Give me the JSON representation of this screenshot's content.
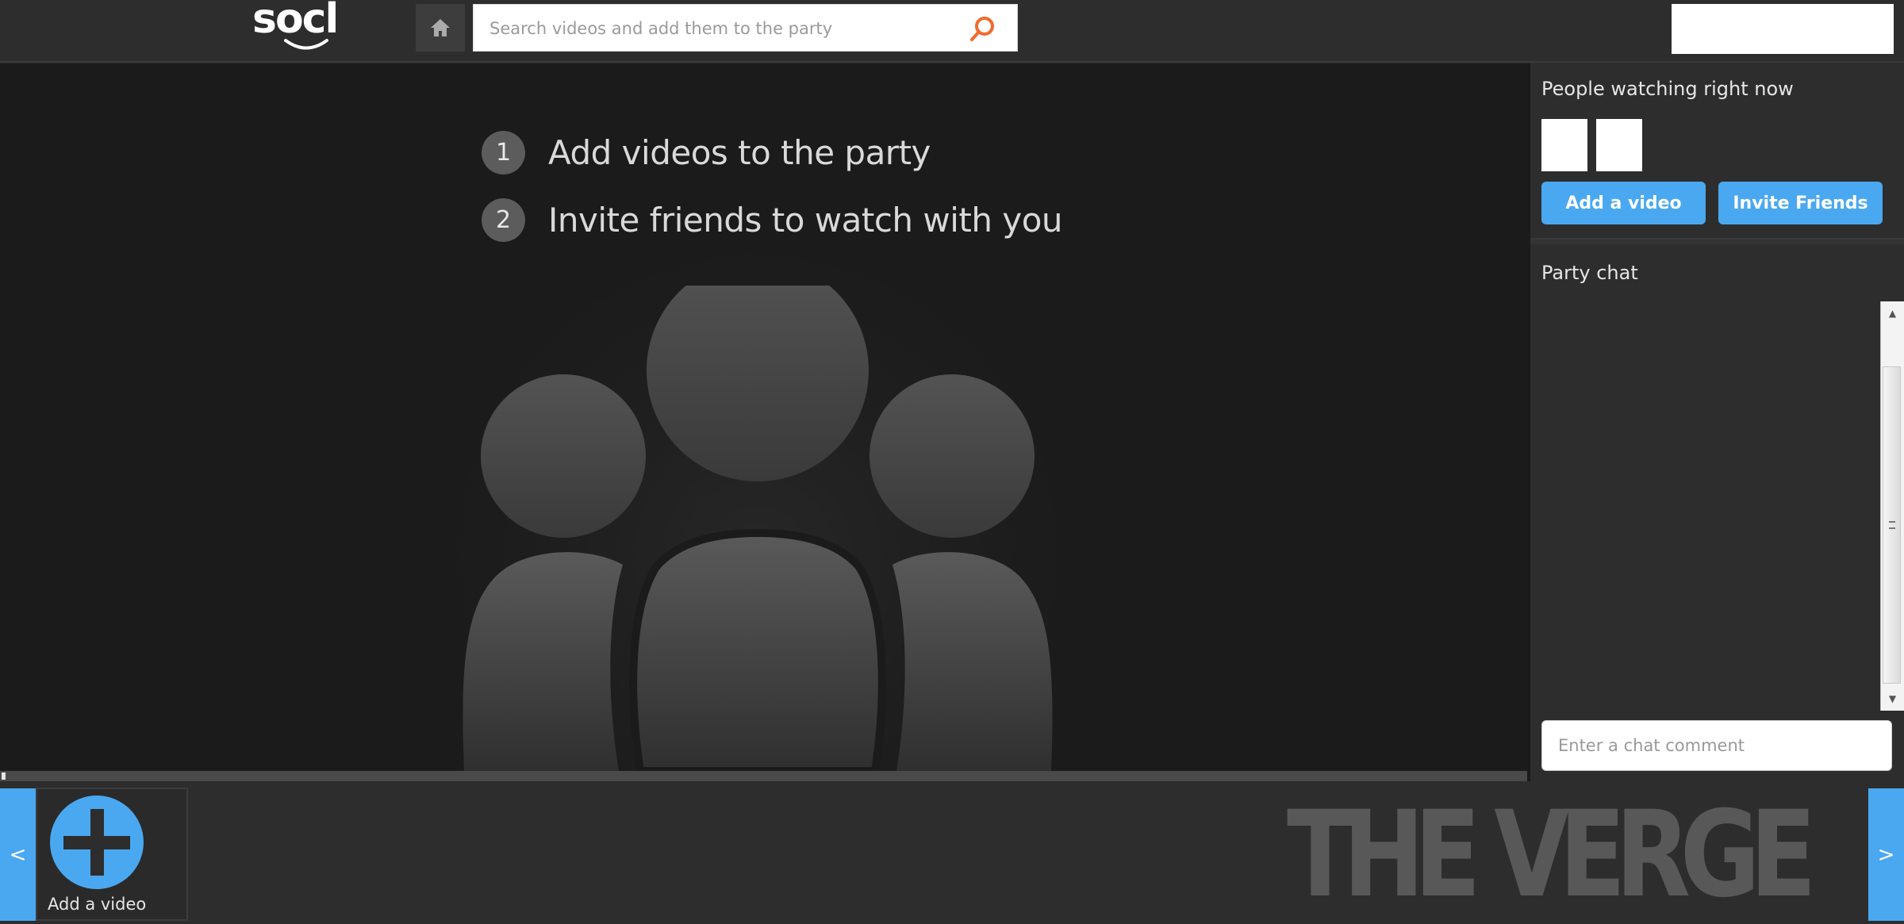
{
  "header": {
    "logo_text": "socl",
    "home_icon": "home-icon",
    "search": {
      "placeholder": "Search videos and add them to the party",
      "value": "",
      "icon": "search-icon",
      "icon_color": "#f26a2e"
    }
  },
  "main": {
    "steps": [
      {
        "number": "1",
        "label": "Add videos to the party"
      },
      {
        "number": "2",
        "label": "Invite friends to watch with you"
      }
    ],
    "illustration": "people-group-icon"
  },
  "sidebar": {
    "people_label": "People watching right now",
    "viewer_count": 2,
    "buttons": {
      "add_video": "Add a video",
      "invite_friends": "Invite Friends"
    },
    "chat": {
      "label": "Party chat",
      "input_placeholder": "Enter a chat comment",
      "input_value": ""
    }
  },
  "queue": {
    "prev_label": "<",
    "next_label": ">",
    "tiles": [
      {
        "label": "Add a video",
        "icon": "plus-circle-icon"
      }
    ]
  },
  "watermark": "THE VERGE",
  "colors": {
    "accent_blue": "#4aa8f0",
    "search_orange": "#f26a2e",
    "header_bg": "#2d2d2d",
    "main_bg": "#1b1b1b"
  }
}
